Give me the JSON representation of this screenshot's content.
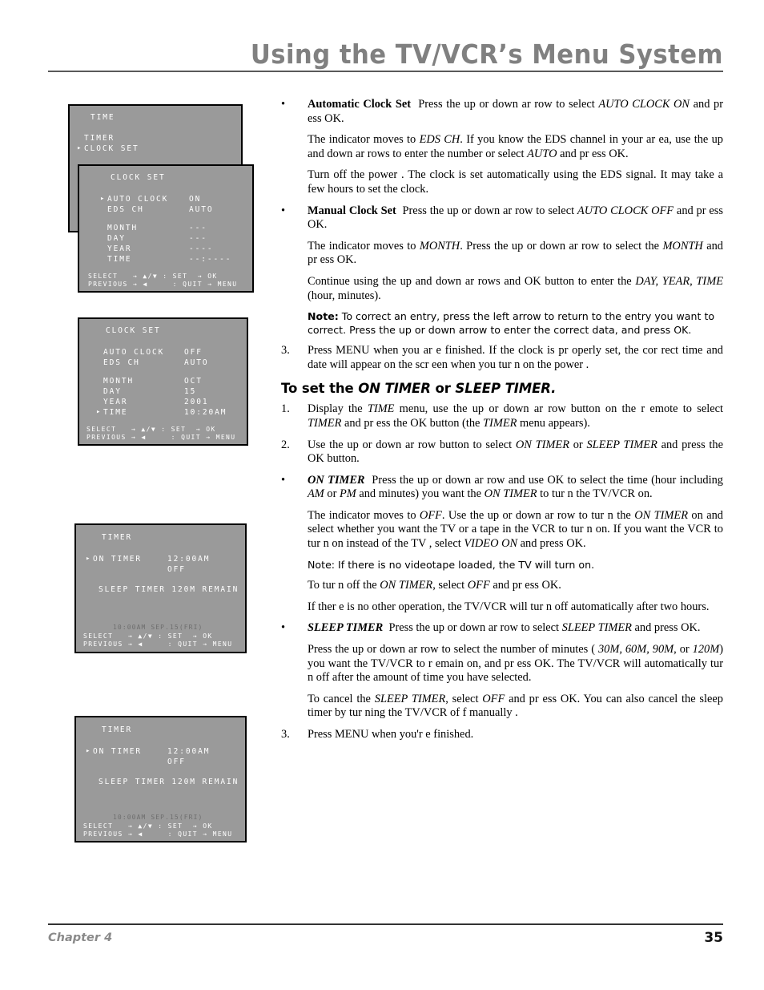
{
  "header": {
    "title": "Using the TV/VCR’s Menu System"
  },
  "footer": {
    "chapter": "Chapter 4",
    "page_number": "35"
  },
  "tv_menus": [
    {
      "id": "time",
      "title": "TIME",
      "rows": [
        {
          "label": "TIMER",
          "value": "",
          "selected": false
        },
        {
          "label": "CLOCK SET",
          "value": "",
          "selected": true
        }
      ],
      "status": "",
      "footer_line1": "SELECT   → ▲/▼ : SET  → OK",
      "footer_line2": "PREVIOUS → ◀     : QUIT → MENU"
    },
    {
      "id": "clock-set-auto",
      "title": "CLOCK SET",
      "rows": [
        {
          "label": "AUTO CLOCK",
          "value": "ON",
          "selected": true
        },
        {
          "label": "EDS CH",
          "value": "AUTO",
          "selected": false
        },
        {
          "label": "MONTH",
          "value": "---",
          "selected": false
        },
        {
          "label": "DAY",
          "value": "---",
          "selected": false
        },
        {
          "label": "YEAR",
          "value": "----",
          "selected": false
        },
        {
          "label": "TIME",
          "value": "--:----",
          "selected": false
        }
      ],
      "status": "",
      "footer_line1": "SELECT   → ▲/▼ : SET  → OK",
      "footer_line2": "PREVIOUS → ◀     : QUIT → MENU"
    },
    {
      "id": "clock-set-manual",
      "title": "CLOCK SET",
      "rows": [
        {
          "label": "AUTO CLOCK",
          "value": "OFF",
          "selected": false
        },
        {
          "label": "EDS CH",
          "value": "AUTO",
          "selected": false
        },
        {
          "label": "MONTH",
          "value": "OCT",
          "selected": false
        },
        {
          "label": "DAY",
          "value": "15",
          "selected": false
        },
        {
          "label": "YEAR",
          "value": "2001",
          "selected": false
        },
        {
          "label": "TIME",
          "value": "10:20AM",
          "selected": true
        }
      ],
      "status": "",
      "footer_line1": "SELECT   → ▲/▼ : SET  → OK",
      "footer_line2": "PREVIOUS → ◀     : QUIT → MENU"
    },
    {
      "id": "timer-a",
      "title": "TIMER",
      "rows": [
        {
          "label": "ON TIMER",
          "value": "12:00AM",
          "selected": true
        },
        {
          "label": "",
          "value": "OFF",
          "selected": false
        },
        {
          "label": "SLEEP TIMER 120M REMAIN",
          "value": "",
          "selected": false
        }
      ],
      "status": "10:00AM SEP.15(FRI)",
      "footer_line1": "SELECT   → ▲/▼ : SET  → OK",
      "footer_line2": "PREVIOUS → ◀     : QUIT → MENU"
    },
    {
      "id": "timer-b",
      "title": "TIMER",
      "rows": [
        {
          "label": "ON TIMER",
          "value": "12:00AM",
          "selected": true
        },
        {
          "label": "",
          "value": "OFF",
          "selected": false
        },
        {
          "label": "SLEEP TIMER 120M REMAIN",
          "value": "",
          "selected": false
        }
      ],
      "status": "10:00AM SEP.15(FRI)",
      "footer_line1": "SELECT   → ▲/▼ : SET  → OK",
      "footer_line2": "PREVIOUS → ◀     : QUIT → MENU"
    }
  ],
  "content": {
    "auto_clock_set": {
      "bullet": "•",
      "term": "Automatic Clock Set",
      "lead_1": "Press the up or down ar  row to select ",
      "lead_em": "AUTO CLOCK ON",
      "lead_2": " and pr ess OK.",
      "para_2_a": "The indicator moves to ",
      "para_2_em1": "EDS CH",
      "para_2_b": ". If you know the EDS channel in your ar  ea, use the up and down ar  rows to enter the number or select ",
      "para_2_em2": "AUTO",
      "para_2_c": " and pr ess OK.",
      "para_3": "Turn off the power . The clock is set automatically using the EDS signal. It may take a few hours to set the clock."
    },
    "manual_clock_set": {
      "bullet": "•",
      "term": "Manual Clock Set",
      "lead_1": "Press the up or down ar  row to select ",
      "lead_em": "AUTO CLOCK OFF",
      "lead_2": " and pr ess OK.",
      "para_2_a": "The indicator moves to ",
      "para_2_em1": "MONTH",
      "para_2_b": ". Press the up or down ar  row to select the ",
      "para_2_em2": "MONTH",
      "para_2_c": " and pr ess OK.",
      "para_3_a": "Continue using the up and down ar   rows and OK button to enter the ",
      "para_3_em": "DAY, YEAR, TIME",
      "para_3_b": " (hour, minutes)."
    },
    "note_correct": {
      "label": "Note:",
      "text": " To correct an entry, press the left arrow to return to the entry you want to correct. Press the up or down arrow to enter the correct data, and press OK."
    },
    "step_3_clock": {
      "mark": "3.",
      "text": "Press MENU when you ar  e finished. If the clock is pr  operly set, the cor  rect time and date will appear on the scr    een when you tur  n on the power ."
    },
    "timer_section": {
      "heading_a": "To set the ",
      "heading_em1": "ON TIMER",
      "heading_b": " or ",
      "heading_em2": "SLEEP TIMER.",
      "step_1": {
        "mark": "1.",
        "a": "Display the ",
        "em1": "TIME",
        "b": " menu, use the up or down ar   row button on the r   emote to select ",
        "em2": "TIMER",
        "c": " and pr ess the OK button (the ",
        "em3": "TIMER",
        "d": " menu appears)."
      },
      "step_2": {
        "mark": "2.",
        "a": "Use the up or down ar  row button to select ",
        "em1": "ON TIMER",
        "b": " or ",
        "em2": "SLEEP TIMER",
        "c": " and press the OK button."
      },
      "on_timer": {
        "bullet": "•",
        "term": "ON TIMER",
        "lead_a": "Press the up or down ar  row and use OK to select the time (hour including ",
        "lead_em1": "AM",
        "lead_b": " or ",
        "lead_em2": "PM",
        "lead_c": " and minutes) you want the ",
        "lead_em3": "ON TIMER",
        "lead_d": " to tur n the TV/VCR on.",
        "para_a": "The indicator moves to ",
        "para_em1": "OFF",
        "para_b": ". Use the up or down ar  row to tur  n the ",
        "para_em2": "ON TIMER",
        "para_c": " on and select whether you want the TV or a tape in the VCR to tur    n on. If you want the VCR to tur   n on instead of the TV  , select ",
        "para_em3": "VIDEO ON",
        "para_d": " and press OK.",
        "note": "Note: If there is no videotape loaded, the TV will turn on.",
        "para_off_a": "To tur n off the ",
        "para_off_em1": "ON TIMER",
        "para_off_b": ", select ",
        "para_off_em2": "OFF",
        "para_off_c": " and pr ess OK.",
        "para_auto_off": "If ther e is no other operation, the TV/VCR will tur    n off automatically after two hours."
      },
      "sleep_timer": {
        "bullet": "•",
        "term": "SLEEP TIMER",
        "lead_a": "Press the up or down ar  row to select ",
        "lead_em": "SLEEP TIMER",
        "lead_b": " and press OK.",
        "para_a": "Press the up or down ar  row to select the number of minutes ( ",
        "para_em": "30M, 60M, 90M",
        "para_b": ", or ",
        "para_em2": "120M",
        "para_c": ") you want the TV/VCR to r  emain on, and pr  ess OK. The TV/VCR will automatically tur   n off after the amount of time you have selected.",
        "cancel_a": "To cancel the ",
        "cancel_em1": "SLEEP TIMER",
        "cancel_b": ", select ",
        "cancel_em2": "OFF",
        "cancel_c": " and pr ess OK. You can also cancel the sleep timer by tur   ning the TV/VCR of f manually ."
      },
      "step_3": {
        "mark": "3.",
        "text": "Press MENU when you'r  e finished."
      }
    }
  }
}
